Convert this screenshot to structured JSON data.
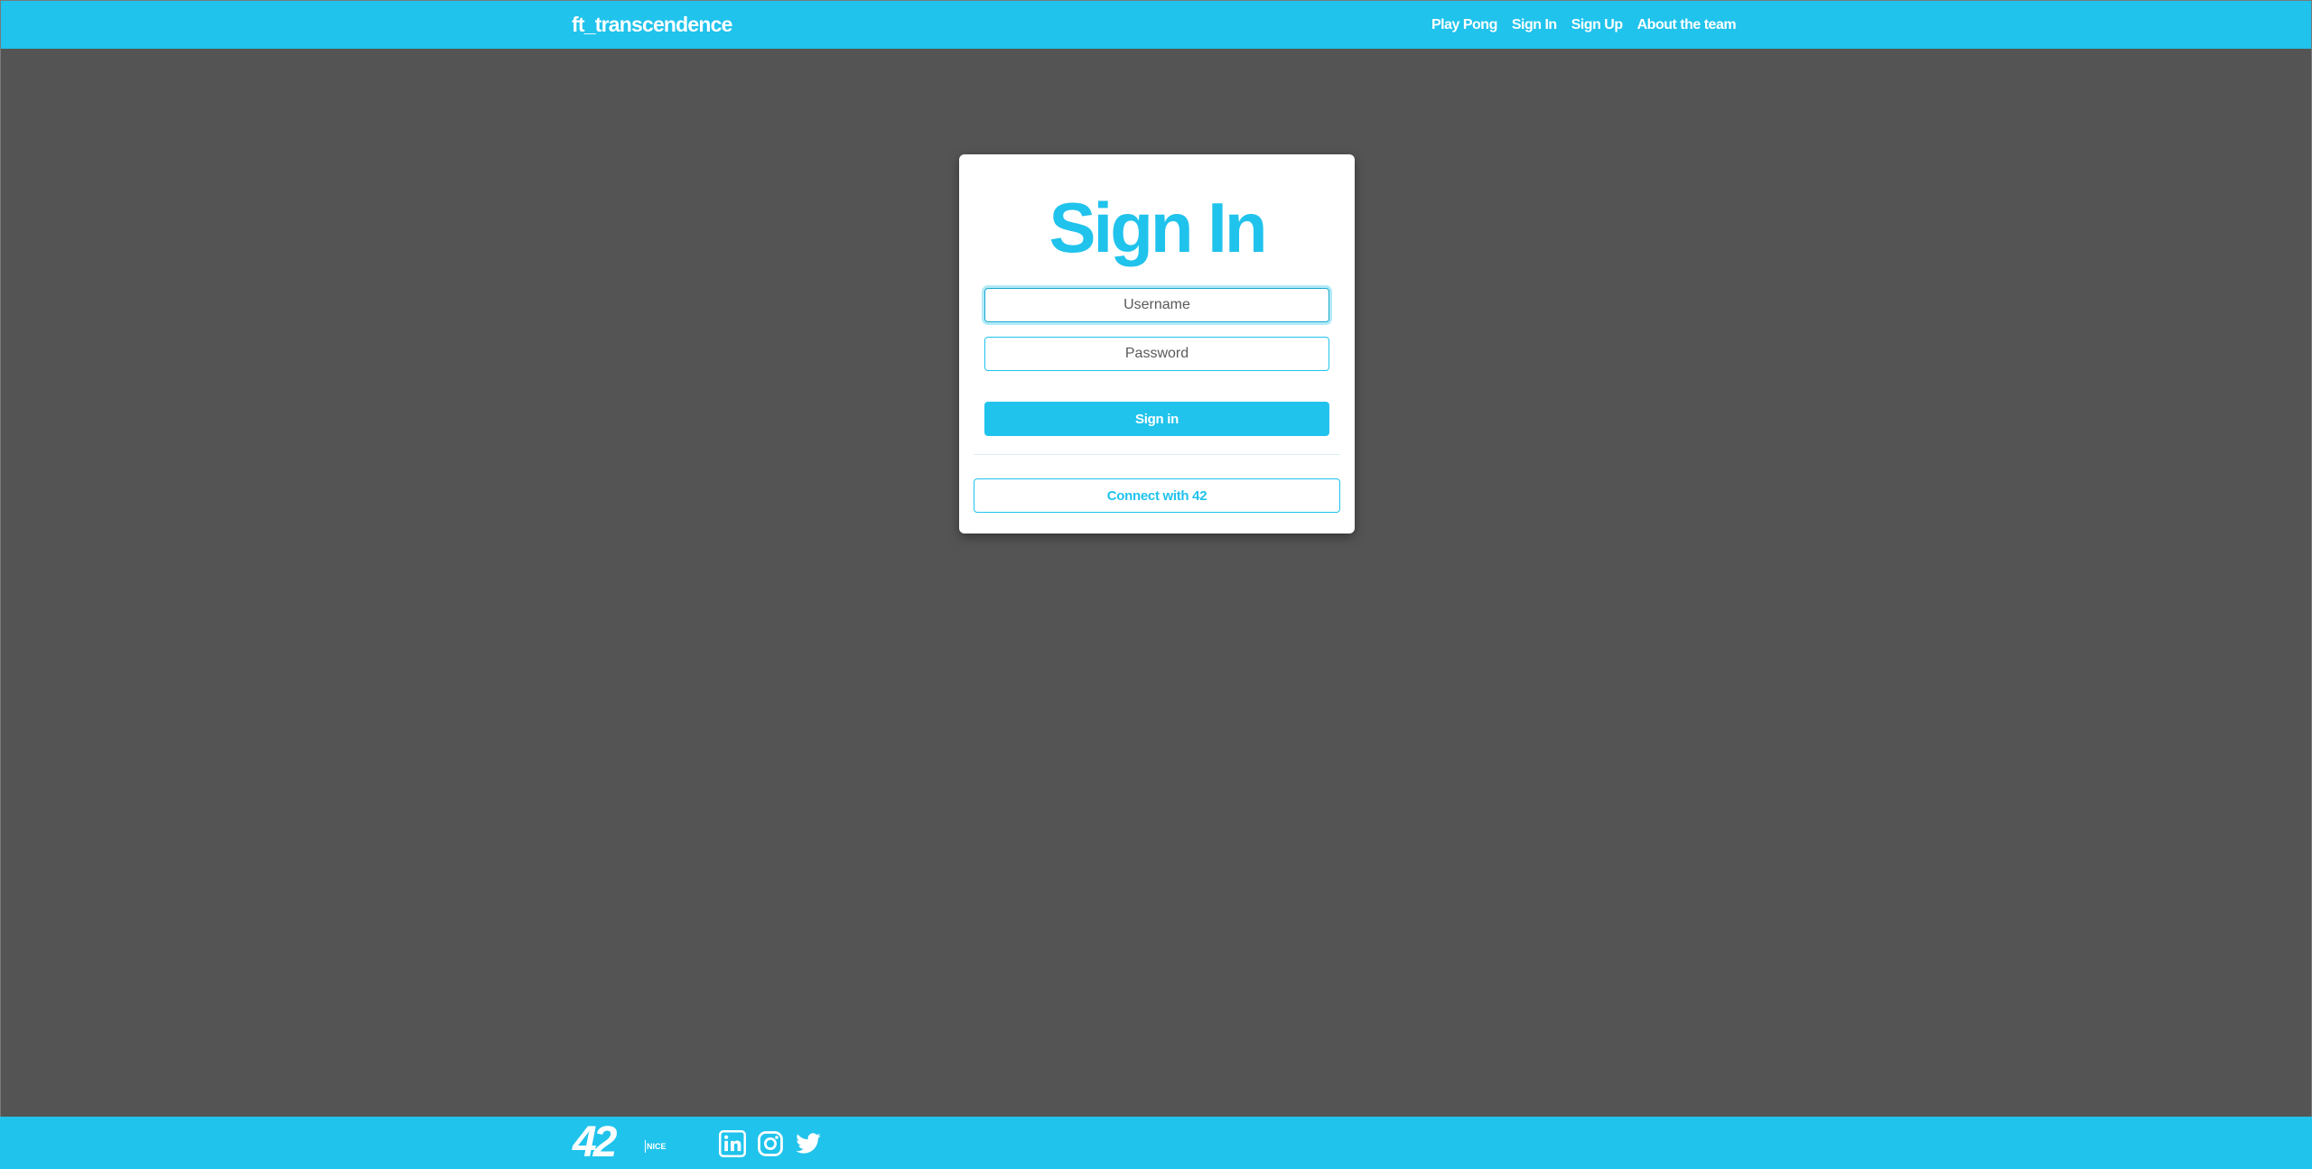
{
  "colors": {
    "accent": "#20c3ec",
    "background": "#545454",
    "card": "#ffffff"
  },
  "navbar": {
    "brand": "ft_transcendence",
    "links": [
      "Play Pong",
      "Sign In",
      "Sign Up",
      "About the team"
    ]
  },
  "signin_card": {
    "title": "Sign In",
    "username_placeholder": "Username",
    "password_placeholder": "Password",
    "submit_label": "Sign in",
    "oauth_label": "Connect with 42"
  },
  "footer": {
    "logo_text": "42",
    "logo_city": "NICE",
    "social_icons": [
      "linkedin-icon",
      "instagram-icon",
      "twitter-icon"
    ]
  }
}
